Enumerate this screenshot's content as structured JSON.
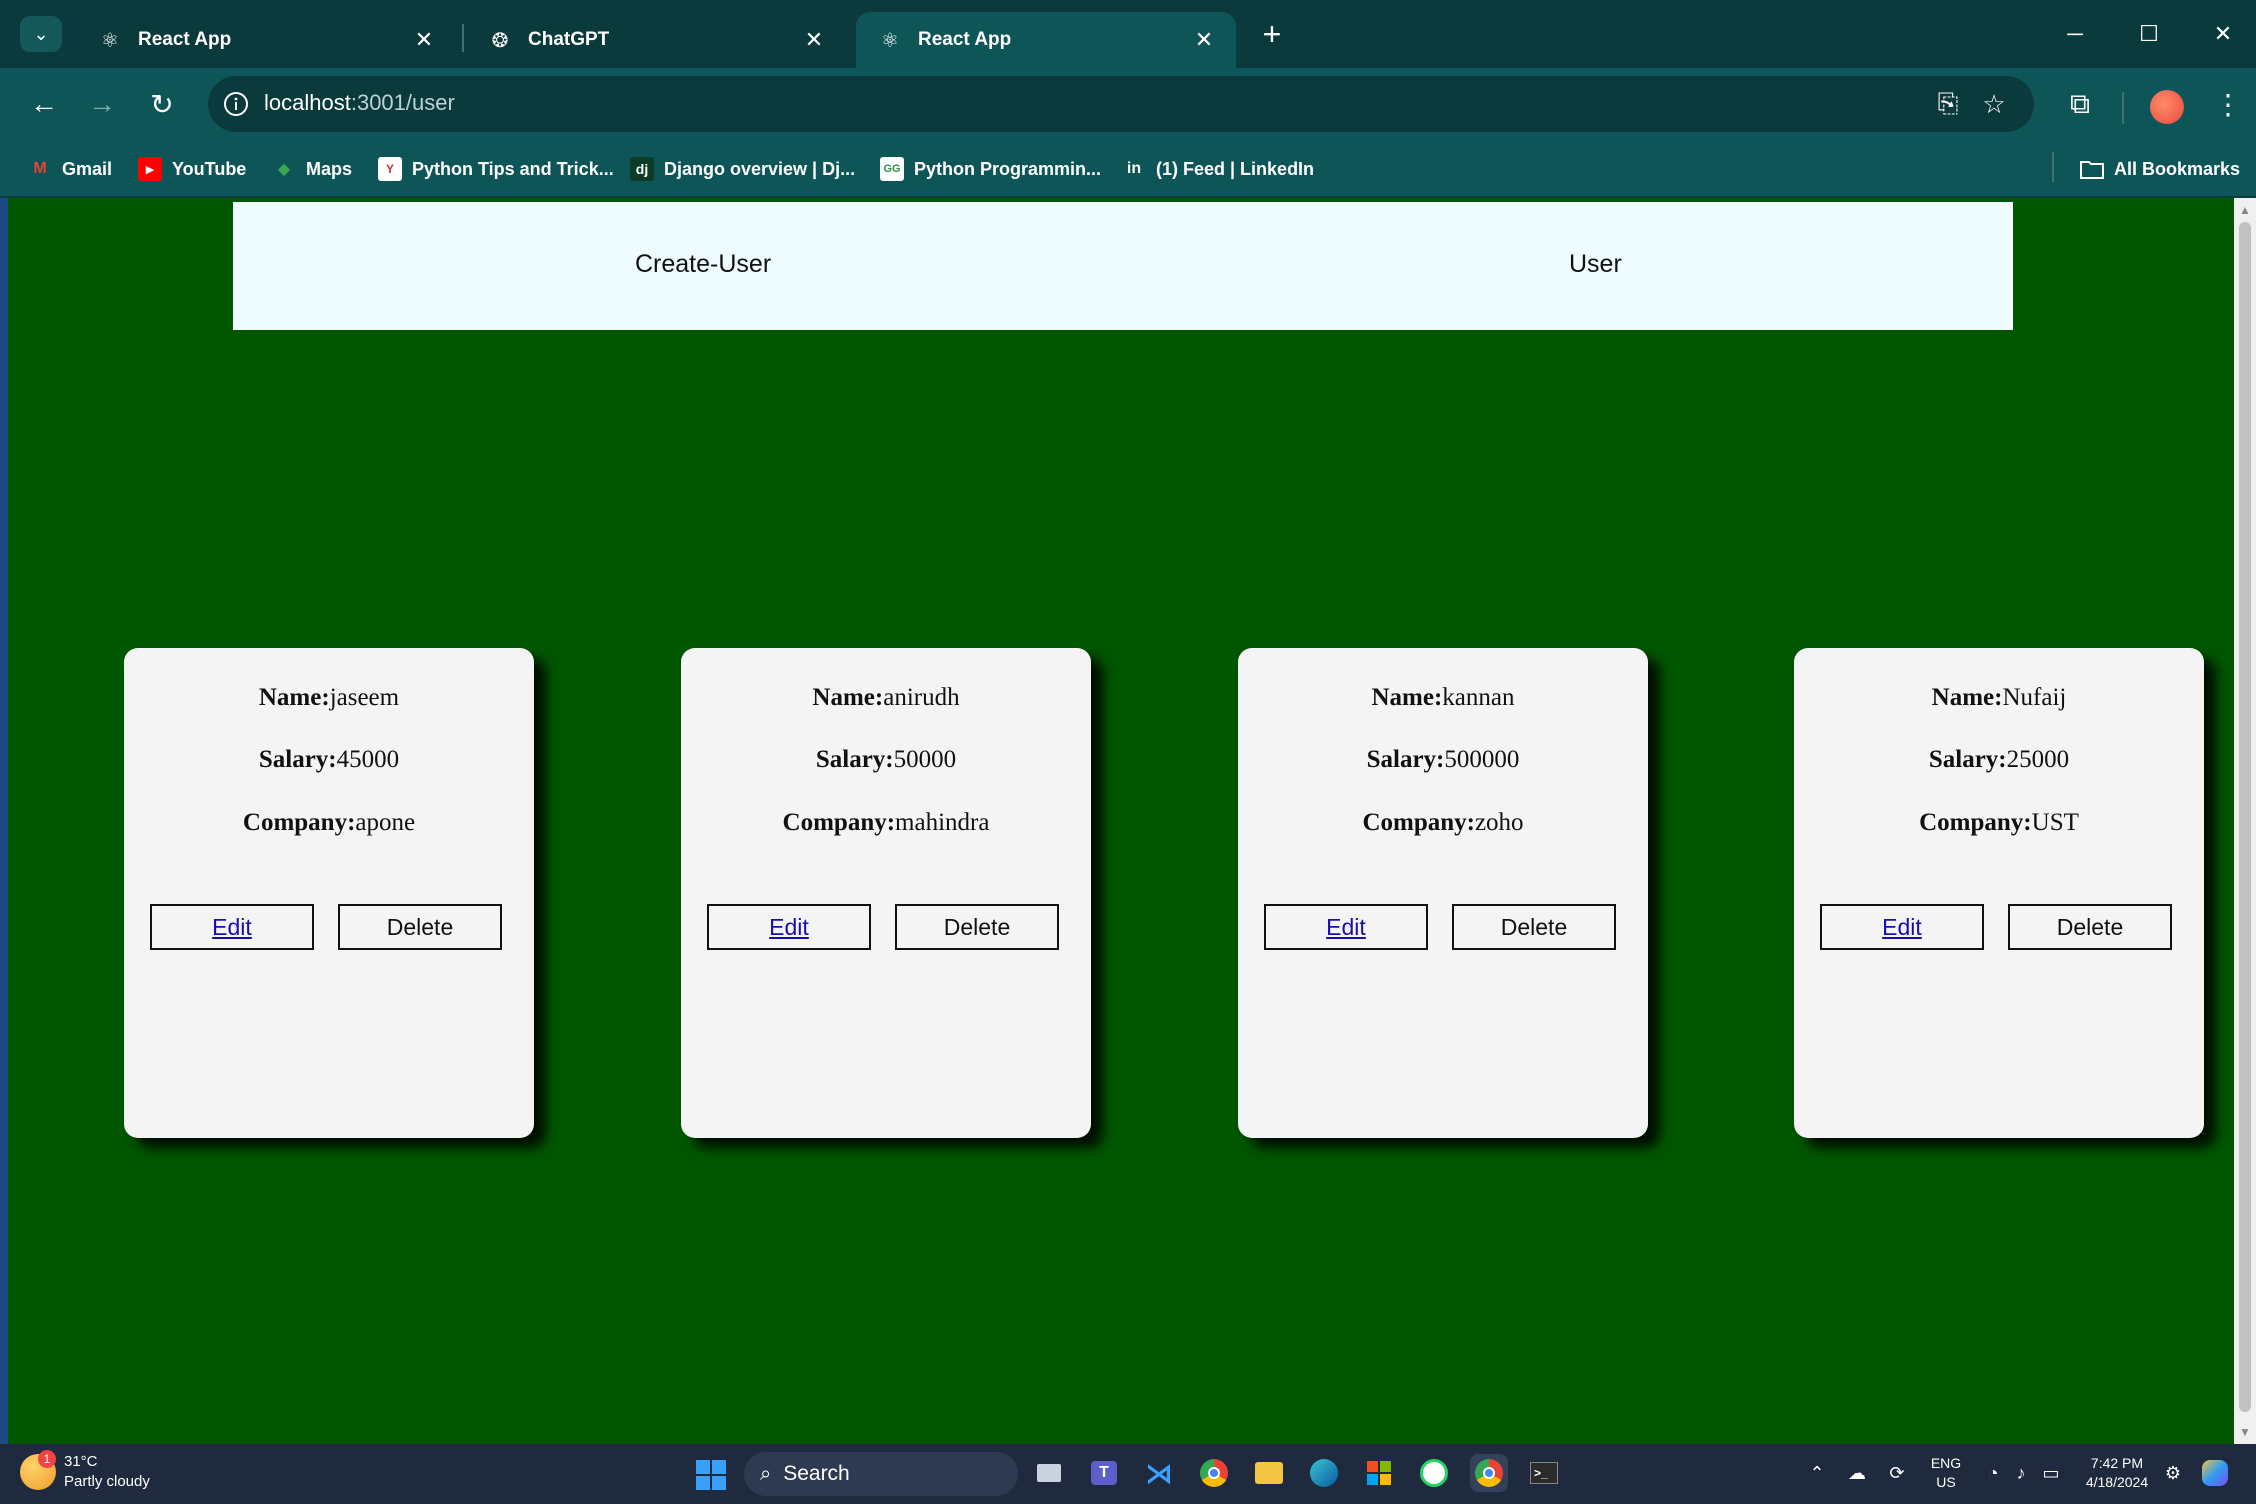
{
  "browser": {
    "tabs": [
      {
        "title": "React App",
        "icon": "react-icon",
        "active": false
      },
      {
        "title": "ChatGPT",
        "icon": "chatgpt-icon",
        "active": false
      },
      {
        "title": "React App",
        "icon": "react-icon",
        "active": true
      }
    ],
    "url_host": "localhost",
    "url_path": ":3001/user",
    "bookmarks": [
      {
        "label": "Gmail",
        "icon": "gmail-icon"
      },
      {
        "label": "YouTube",
        "icon": "youtube-icon"
      },
      {
        "label": "Maps",
        "icon": "maps-icon"
      },
      {
        "label": "Python Tips and Trick...",
        "icon": "site-icon"
      },
      {
        "label": "Django overview | Dj...",
        "icon": "django-icon"
      },
      {
        "label": "Python Programmin...",
        "icon": "site-icon"
      },
      {
        "label": "(1) Feed | LinkedIn",
        "icon": "linkedin-icon"
      }
    ],
    "all_bookmarks_label": "All Bookmarks"
  },
  "page": {
    "nav": {
      "create_user": "Create-User",
      "user": "User"
    },
    "labels": {
      "name": "Name:",
      "salary": "Salary:",
      "company": "Company:",
      "edit": "Edit",
      "delete": "Delete"
    },
    "users": [
      {
        "name": "jaseem",
        "salary": "45000",
        "company": "apone"
      },
      {
        "name": "anirudh",
        "salary": "50000",
        "company": "mahindra"
      },
      {
        "name": "kannan",
        "salary": "500000",
        "company": "zoho"
      },
      {
        "name": "Nufaij",
        "salary": "25000",
        "company": "UST"
      }
    ],
    "colors": {
      "background": "#005700",
      "navbar": "#eefcff",
      "card": "#f4f4f4"
    }
  },
  "taskbar": {
    "weather_badge": "1",
    "temperature": "31°C",
    "condition": "Partly cloudy",
    "search_label": "Search",
    "language": "ENG",
    "region": "US",
    "time": "7:42 PM",
    "date": "4/18/2024"
  }
}
